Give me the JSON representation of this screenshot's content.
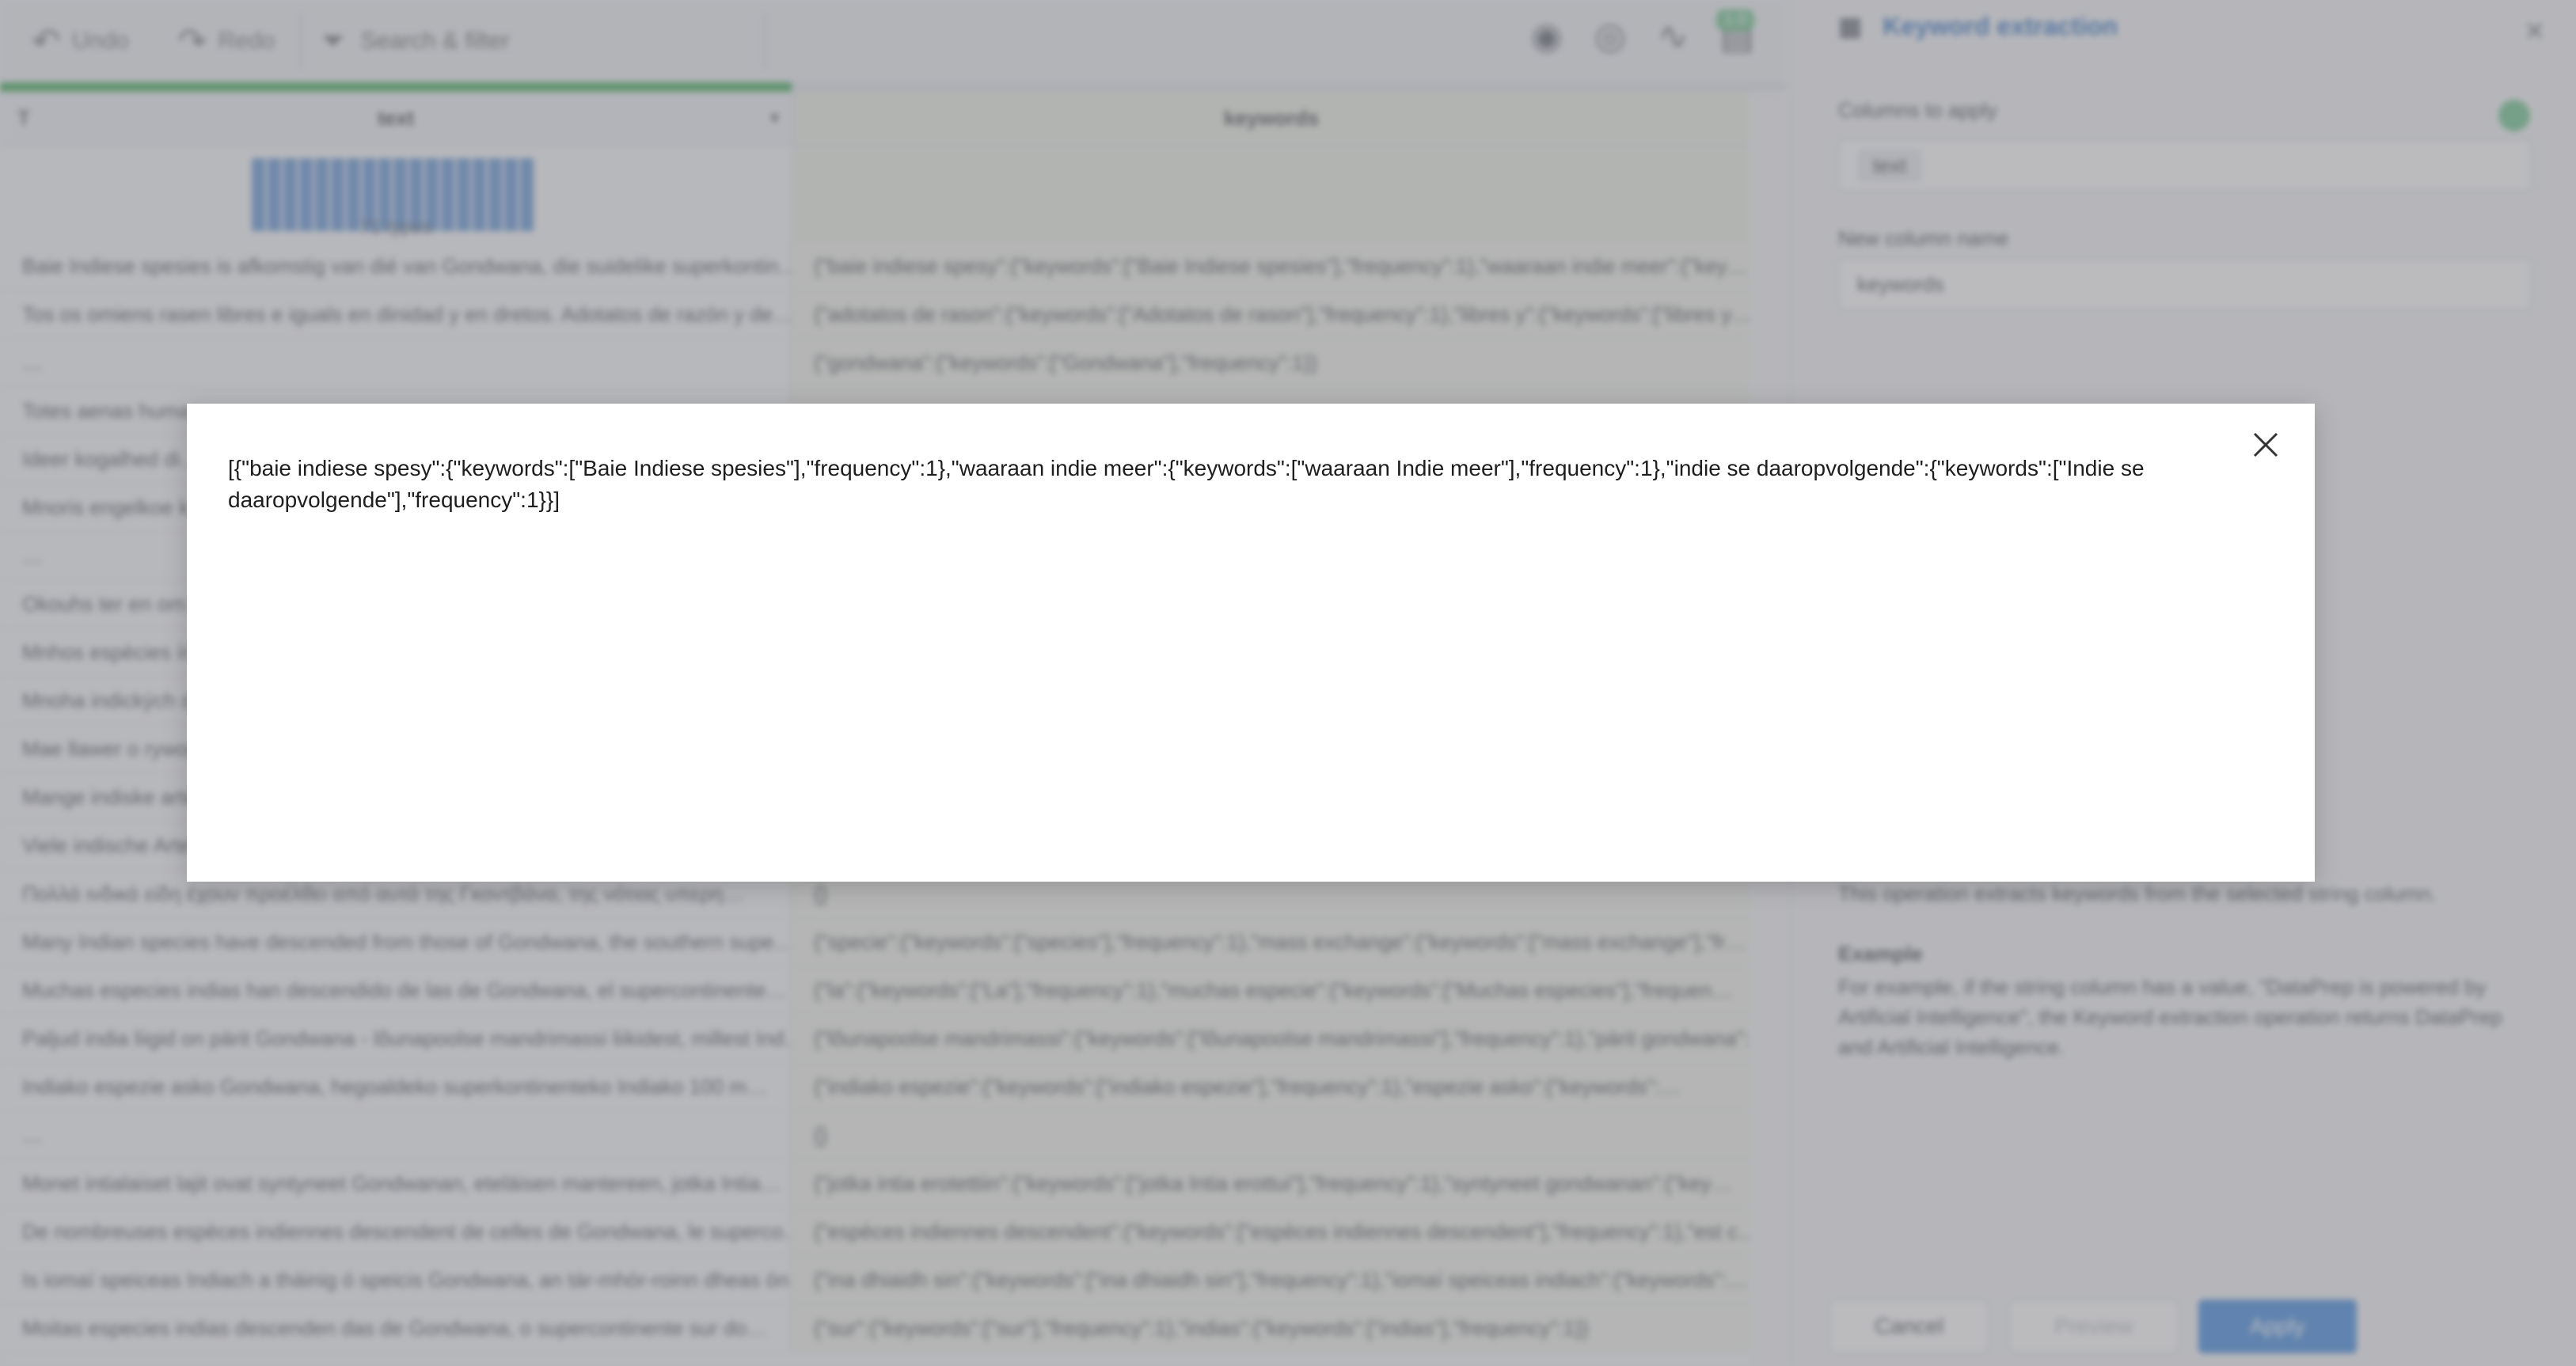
{
  "toolbar": {
    "undo_label": "Undo",
    "redo_label": "Redo",
    "search_placeholder": "Search & filter",
    "badge": "1.0"
  },
  "grid": {
    "columns": [
      {
        "type_glyph": "T",
        "name": "text"
      },
      {
        "name": "keywords"
      }
    ],
    "histogram_label": "71 types",
    "rows": [
      {
        "text": "Baie Indiese spesies is afkomstig van dié van Gondwana, die suidelike superkontin…",
        "keywords": "{\"baie indiese spesy\":{\"keywords\":[\"Baie Indiese spesies\"],\"frequency\":1},\"waaraan indie meer\":{\"key…"
      },
      {
        "text": "Tos os omiens rasen libres e iguals en dinidad y en dretos. Adotatos de razón y de…",
        "keywords": "{\"adotatos de rason\":{\"keywords\":[\"Adotatos de rason\"],\"frequency\":1},\"libres y\":{\"keywords\":[\"libres y…"
      },
      {
        "text": "…",
        "keywords": "{\"gondwana\":{\"keywords\":[\"Gondwana\"],\"frequency\":1}}"
      },
      {
        "text": "Totes aenas human…",
        "keywords": ""
      },
      {
        "text": "Ideer kogalhed di…",
        "keywords": ""
      },
      {
        "text": "Mnoris engelkoe k…",
        "keywords": ""
      },
      {
        "text": "…",
        "keywords": ""
      },
      {
        "text": "Okouhs ter en om…",
        "keywords": ""
      },
      {
        "text": "Mnhos espècies ín…",
        "keywords": ""
      },
      {
        "text": "Mnoha indických d…",
        "keywords": ""
      },
      {
        "text": "Mae llawer o rywog…",
        "keywords": ""
      },
      {
        "text": "Mange indiske arte…",
        "keywords": ""
      },
      {
        "text": "Viele indische Arte…",
        "keywords": ""
      },
      {
        "text": "Πολλά ινδικά είδη έχουν προέλθει από αυτά της Γκοντβάνα, της νότιας υπερη…",
        "keywords": "{}"
      },
      {
        "text": "Many Indian species have descended from those of Gondwana, the southern supe…",
        "keywords": "{\"specie\":{\"keywords\":[\"species\"],\"frequency\":1},\"mass exchange\":{\"keywords\":[\"mass exchange\"],\"fr…"
      },
      {
        "text": "Muchas especies indias han descendido de las de Gondwana, el supercontinente…",
        "keywords": "{\"la\":{\"keywords\":[\"La\"],\"frequency\":1},\"muchas especie\":{\"keywords\":[\"Muchas especies\"],\"frequen…"
      },
      {
        "text": "Paljud india liigid on pärit Gondwana - lõunapoolse mandrimassi liikidest, millest Ind…",
        "keywords": "{\"lõunapoolse mandrimassi\":{\"keywords\":[\"lõunapoolse mandrimassi\"],\"frequency\":1},\"pärit gondwana\":{…"
      },
      {
        "text": "Indiako espezie asko Gondwana, hegoaldeko superkontinenteko Indiako 100 m…",
        "keywords": "{\"indiako espezie\":{\"keywords\":[\"indiako espezie\"],\"frequency\":1},\"espezie asko\":{\"keywords\":…"
      },
      {
        "text": "…",
        "keywords": "{}"
      },
      {
        "text": "Monet intialaiset lajit ovat syntyneet Gondwanan, eteläisen mantereen, jotka Intia…",
        "keywords": "{\"jotka intia erotettiin\":{\"keywords\":[\"jotka Intia erottui\"],\"frequency\":1},\"syntyneet gondwanan\":{\"key…"
      },
      {
        "text": "De nombreuses espèces indiennes descendent de celles de Gondwana, le superco…",
        "keywords": "{\"espèces indiennes descendent\":{\"keywords\":[\"espèces indiennes descendent\"],\"frequency\":1},\"est c…"
      },
      {
        "text": "Is iomaí speiceas Indiach a tháinig ó speicis Gondwana, an tár-mhòr-roinn dheas óna…",
        "keywords": "{\"ina dhiaidh sin\":{\"keywords\":[\"ina dhiaidh sin\"],\"frequency\":1},\"iomaí speiceas indiach\":{\"keywords\":…"
      },
      {
        "text": "Moitas especies indias descenden das de Gondwana, o supercontinente sur do…",
        "keywords": "{\"sur\":{\"keywords\":[\"sur\"],\"frequency\":1},\"indias\":{\"keywords\":[\"indias\"],\"frequency\":1}}"
      }
    ]
  },
  "panel": {
    "title": "Keyword extraction",
    "columns_label": "Columns to apply",
    "column_chip": "text",
    "new_column_label": "New column name",
    "new_column_value": "keywords",
    "description": "This operation extracts keywords from the selected string column.",
    "example_label": "Example",
    "example_text": "For example, if the string column has a value, \"DataPrep is powered by Artificial Intelligence\", the Keyword extraction operation returns DataPrep and Artificial Intelligence.",
    "cancel_label": "Cancel",
    "preview_label": "Preview",
    "apply_label": "Apply"
  },
  "modal": {
    "content": "[{\"baie indiese spesy\":{\"keywords\":[\"Baie Indiese spesies\"],\"frequency\":1},\"waaraan indie meer\":{\"keywords\":[\"waaraan Indie meer\"],\"frequency\":1},\"indie se daaropvolgende\":{\"keywords\":[\"Indie se daaropvolgende\"],\"frequency\":1}}]"
  }
}
